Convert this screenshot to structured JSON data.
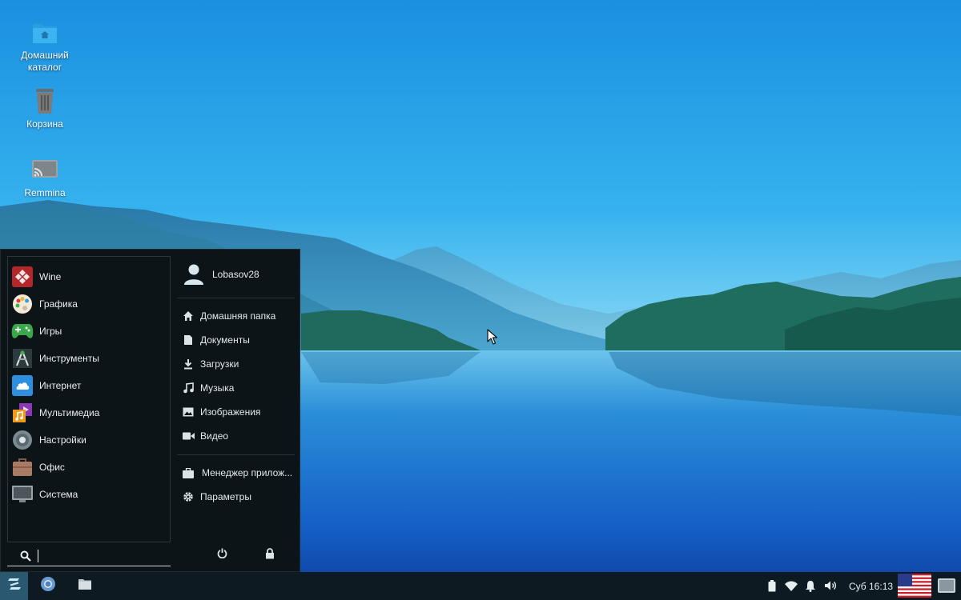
{
  "desktop": {
    "icons": [
      {
        "label": "Домашний каталог",
        "icon": "home-folder-icon"
      },
      {
        "label": "Корзина",
        "icon": "trash-icon"
      },
      {
        "label": "Remmina",
        "icon": "remmina-icon"
      }
    ]
  },
  "menu": {
    "categories": [
      {
        "label": "Wine",
        "icon": "wine-icon"
      },
      {
        "label": "Графика",
        "icon": "palette-icon"
      },
      {
        "label": "Игры",
        "icon": "gamepad-icon"
      },
      {
        "label": "Инструменты",
        "icon": "tools-icon"
      },
      {
        "label": "Интернет",
        "icon": "cloud-icon"
      },
      {
        "label": "Мультимедиа",
        "icon": "multimedia-icon"
      },
      {
        "label": "Настройки",
        "icon": "settings-gear-icon"
      },
      {
        "label": "Офис",
        "icon": "briefcase-icon"
      },
      {
        "label": "Система",
        "icon": "monitor-icon"
      }
    ],
    "search": {
      "value": "",
      "icon": "search-icon"
    },
    "user": {
      "name": "Lobasov28",
      "icon": "user-icon"
    },
    "places": [
      {
        "label": "Домашняя папка",
        "icon": "home-icon"
      },
      {
        "label": "Документы",
        "icon": "document-icon"
      },
      {
        "label": "Загрузки",
        "icon": "download-icon"
      },
      {
        "label": "Музыка",
        "icon": "music-icon"
      },
      {
        "label": "Изображения",
        "icon": "image-icon"
      },
      {
        "label": "Видео",
        "icon": "video-icon"
      }
    ],
    "system": [
      {
        "label": "Менеджер прилож...",
        "icon": "app-manager-icon"
      },
      {
        "label": "Параметры",
        "icon": "gear-icon"
      }
    ],
    "actions": [
      {
        "icon": "power-icon"
      },
      {
        "icon": "lock-icon"
      }
    ]
  },
  "taskbar": {
    "start_icon": "zorin-logo-icon",
    "apps": [
      {
        "icon": "chromium-icon"
      },
      {
        "icon": "file-manager-icon"
      }
    ],
    "tray": [
      {
        "icon": "battery-icon"
      },
      {
        "icon": "wifi-icon"
      },
      {
        "icon": "notification-bell-icon"
      },
      {
        "icon": "volume-icon"
      }
    ],
    "clock": "Суб 16:13",
    "keyboard_layout_icon": "us-flag-icon",
    "show_desktop_icon": "show-desktop-icon"
  },
  "colors": {
    "menu_bg": "#0c1418",
    "taskbar_bg": "#0e1a22",
    "accent": "#4fb3e8"
  }
}
